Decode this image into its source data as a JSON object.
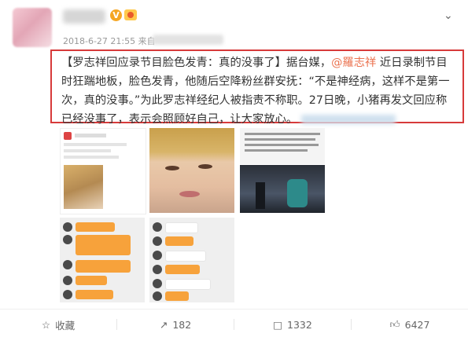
{
  "post": {
    "timestamp": "2018-6-27 21:55 来自",
    "v_badge": "V"
  },
  "body_text": {
    "headline": "【罗志祥回应录节目脸色发青：真的没事了】",
    "seg1": "据台媒，",
    "mention": "@羅志祥",
    "seg2": " 近日录制节目时狂踹地板，脸色发青，他随后空降粉丝群安抚：“不是神经病，这样不是第一次，真的没事。”为此罗志祥经纪人被指责不称职。27日晚，小猪再发文回应称已经没事了，表示会照顾好自己，让大家放心。"
  },
  "actions": {
    "favorite_label": "收藏",
    "repost_count": "182",
    "comment_count": "1332",
    "like_count": "6427"
  },
  "colors": {
    "border_red": "#d73a3a",
    "link_orange": "#eb7350",
    "chat_orange": "#f7a23b"
  }
}
